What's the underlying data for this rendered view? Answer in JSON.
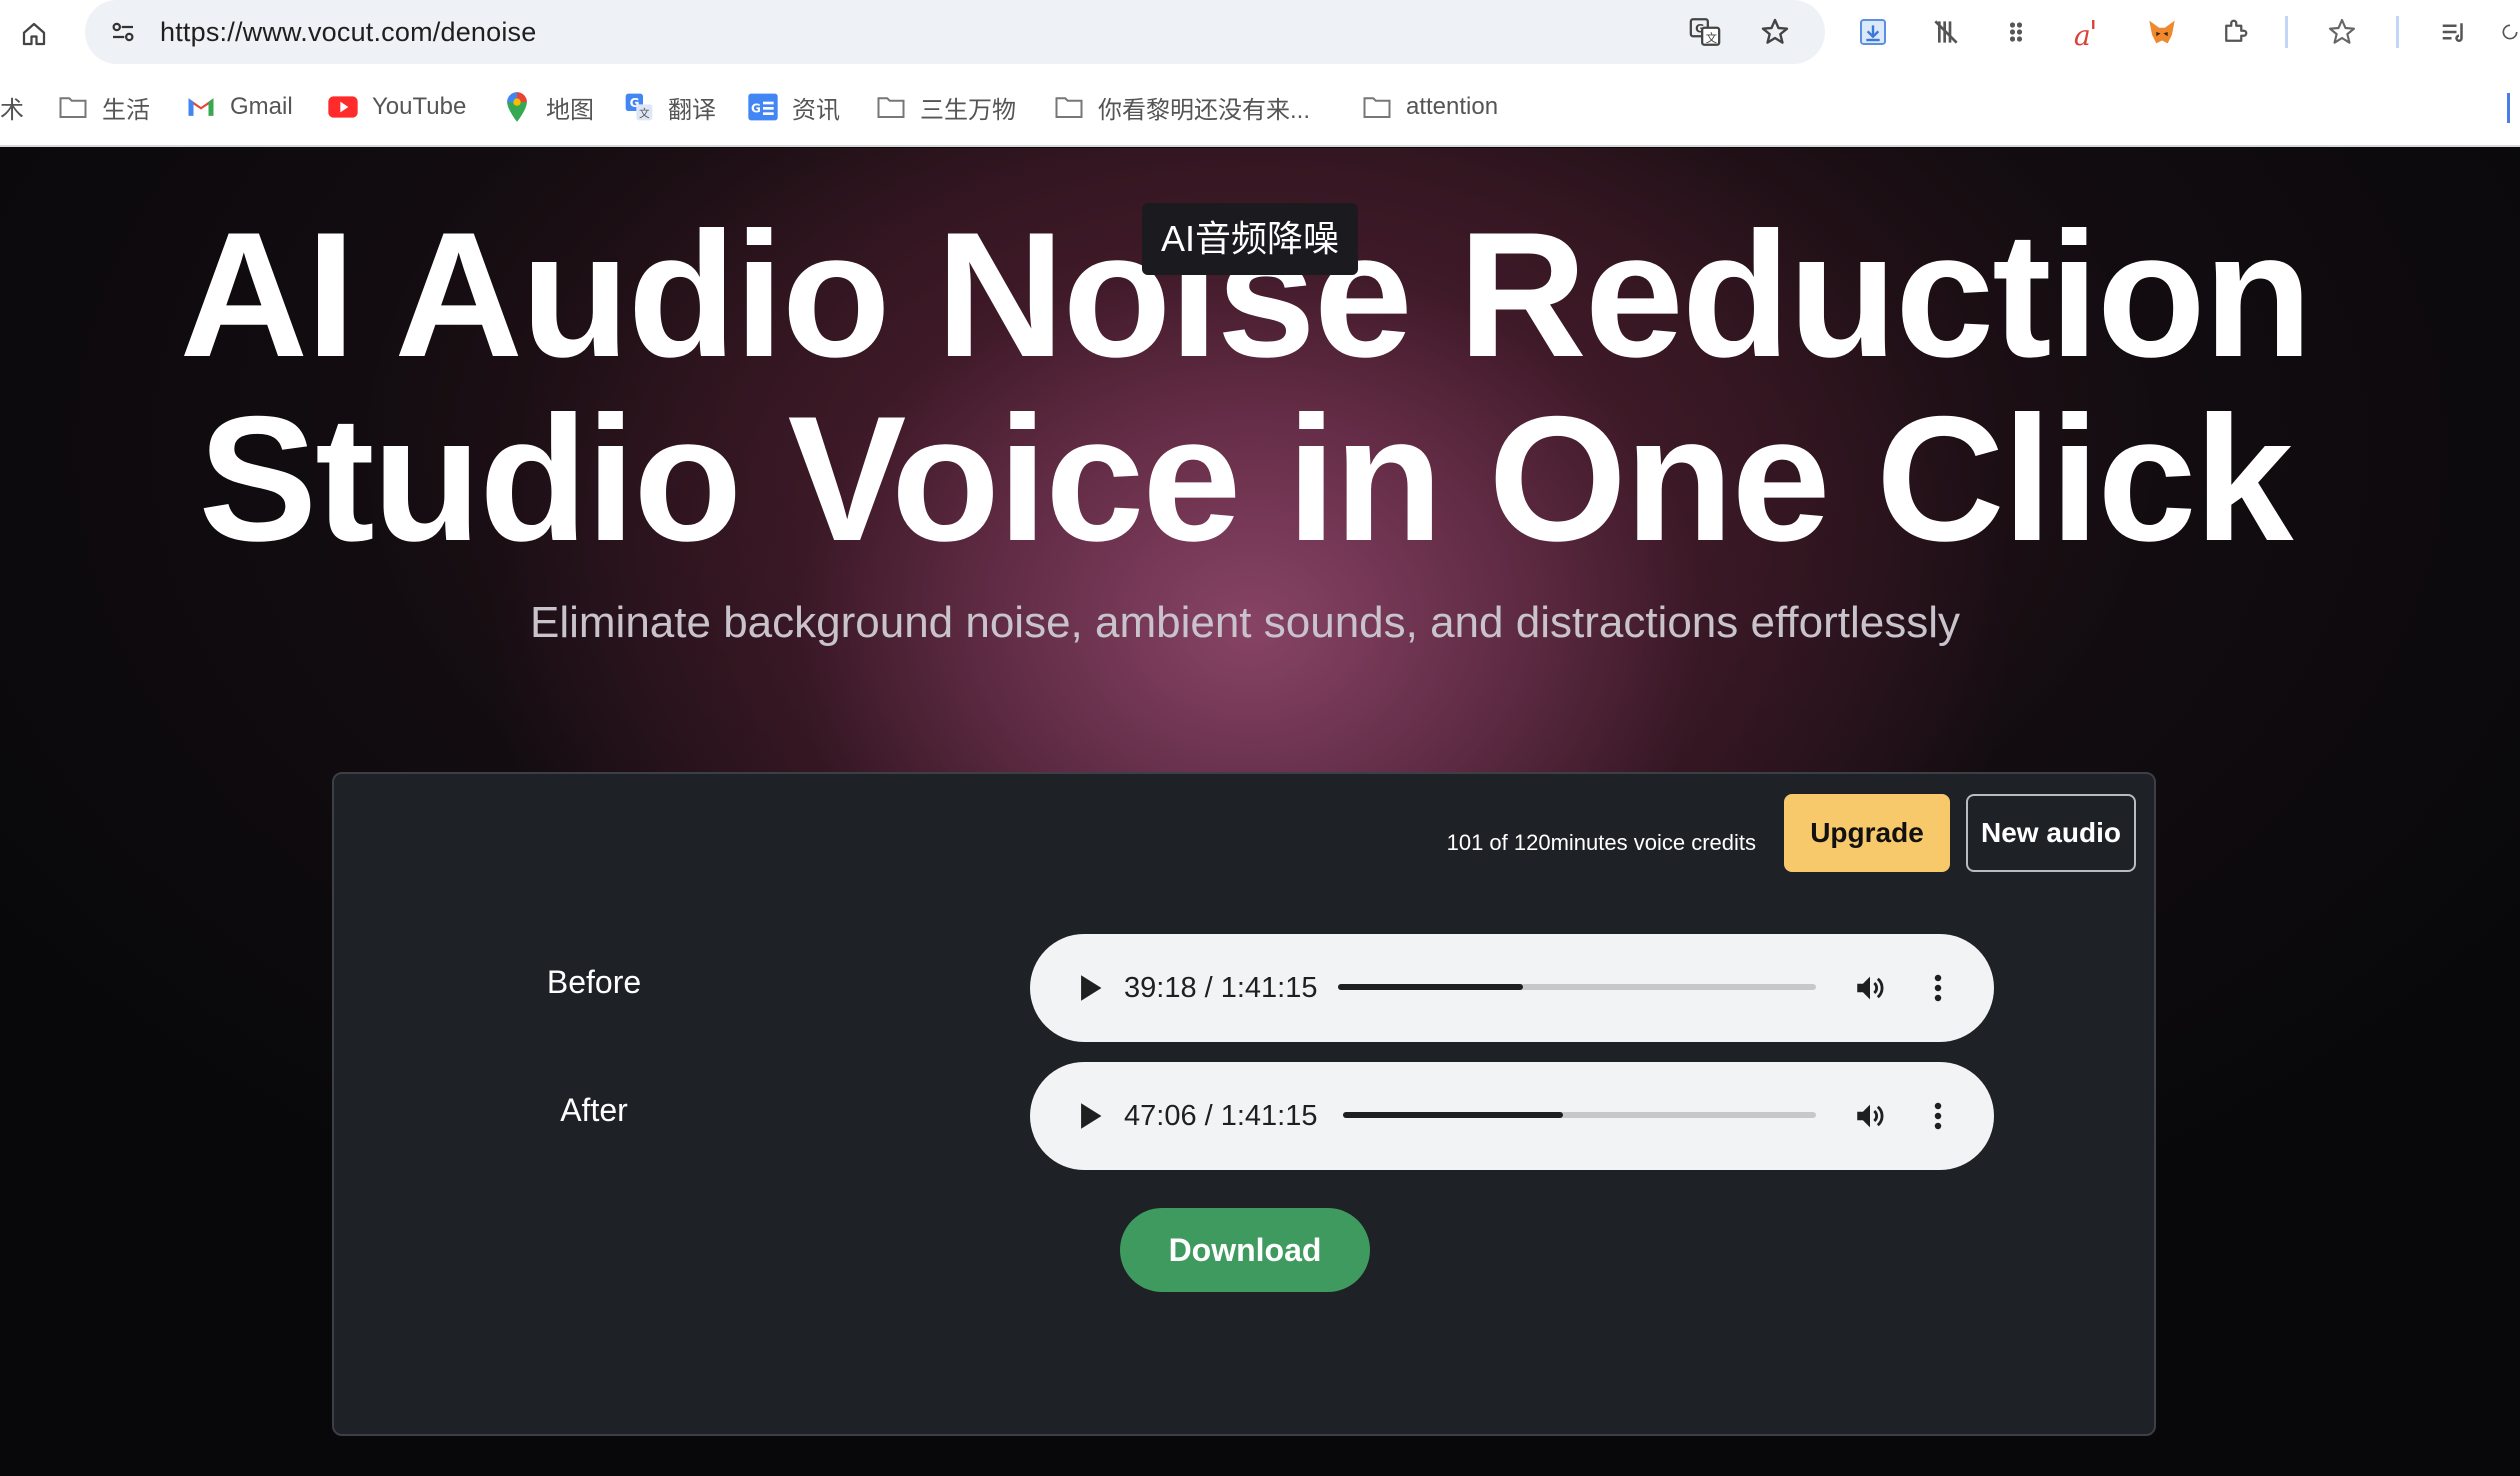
{
  "browser": {
    "url": "https://www.vocut.com/denoise",
    "bookmarks": [
      {
        "label": "术",
        "icon": "truncated"
      },
      {
        "label": "生活",
        "icon": "folder-icon"
      },
      {
        "label": "Gmail",
        "icon": "gmail-icon"
      },
      {
        "label": "YouTube",
        "icon": "youtube-icon"
      },
      {
        "label": "地图",
        "icon": "maps-icon"
      },
      {
        "label": "翻译",
        "icon": "translate-icon"
      },
      {
        "label": "资讯",
        "icon": "news-icon"
      },
      {
        "label": "三生万物",
        "icon": "folder-icon"
      },
      {
        "label": "你看黎明还没有来...",
        "icon": "folder-icon"
      },
      {
        "label": "attention",
        "icon": "folder-icon"
      }
    ]
  },
  "hero": {
    "title_line1": "AI Audio Noise Reduction",
    "title_line2": "Studio Voice in One Click",
    "tooltip": "AI音频降噪",
    "subtitle": "Eliminate background noise, ambient sounds, and distractions effortlessly"
  },
  "card": {
    "credits": "101 of 120minutes voice credits",
    "upgrade_label": "Upgrade",
    "new_audio_label": "New audio",
    "download_label": "Download",
    "players": [
      {
        "label": "Before",
        "time": "39:18 / 1:41:15",
        "progress": 0.388
      },
      {
        "label": "After",
        "time": "47:06 / 1:41:15",
        "progress": 0.465
      }
    ]
  },
  "colors": {
    "upgrade": "#f7c96b",
    "download": "#3e9a5f",
    "card_bg": "#1e2126"
  }
}
